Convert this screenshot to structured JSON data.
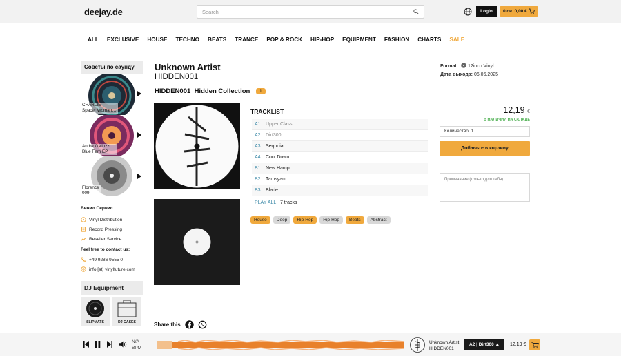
{
  "header": {
    "logo": "deejay.de",
    "search_placeholder": "Search",
    "login_label": "Login",
    "cart_label": "0 св. 0,00 €"
  },
  "nav": {
    "items": [
      "ALL",
      "EXCLUSIVE",
      "HOUSE",
      "TECHNO",
      "BEATS",
      "TRANCE",
      "POP & ROCK",
      "HIP-HOP",
      "EQUIPMENT",
      "FASHION",
      "CHARTS",
      "SALE"
    ]
  },
  "sidebar": {
    "recommend_title": "Советы по саунду",
    "recommendations": [
      {
        "line1": "CHARLIE",
        "line2": "Spacer Woman…"
      },
      {
        "line1": "Andre Galluzzi …",
        "line2": "Blue Fern EP"
      },
      {
        "line1": "Florence",
        "line2": "009"
      }
    ],
    "services_title": "Винил Сервис",
    "services": [
      "Vinyl Distribution",
      "Record Pressing",
      "Reseller Service"
    ],
    "contact_title": "Feel free to contact us:",
    "phone": "+49 9286 9555 0",
    "email": "info [at] vinylfuture.com",
    "dj_title": "DJ Equipment",
    "dj_items": [
      "SLIPMATS",
      "DJ CASES"
    ]
  },
  "release": {
    "artist": "Unknown Artist",
    "catalog": "HIDDEN001",
    "title_catalog": "HIDDEN001",
    "title_label": "Hidden Collection",
    "count_badge": "1",
    "format_label": "Format:",
    "format_value": "12inch Vinyl",
    "date_label": "Дата выхода:",
    "date_value": "06.06.2025"
  },
  "tracklist": {
    "title": "TRACKLIST",
    "tracks": [
      {
        "pos": "A1:",
        "name": "Upper Class"
      },
      {
        "pos": "A2:",
        "name": "Dirt300"
      },
      {
        "pos": "A3:",
        "name": "Sequoia"
      },
      {
        "pos": "A4:",
        "name": "Cool Down"
      },
      {
        "pos": "B1:",
        "name": "New Hamp"
      },
      {
        "pos": "B2:",
        "name": "Tamsyam"
      },
      {
        "pos": "B3:",
        "name": "Blade"
      }
    ],
    "play_all": "PLAY ALL",
    "track_count": "7 tracks"
  },
  "tags": [
    "House",
    "Deep",
    "Hip-Hop",
    "Hip-Hop",
    "Beats",
    "Abstract"
  ],
  "purchase": {
    "price": "12,19",
    "currency": "€",
    "stock": "В НАЛИЧИИ НА СКЛАДЕ",
    "qty_label": "Количество",
    "qty_value": "1",
    "add_button": "Добавьте в корзину",
    "note_placeholder": "Примечание (только для тебя)"
  },
  "share": {
    "label": "Share this"
  },
  "player": {
    "status_na": "N/A",
    "status_bpm": "BPM",
    "artist": "Unknown Artist",
    "catalog": "HIDDEN001",
    "current_track": "A2 | Dirt300 ▲",
    "price": "12,19 €"
  },
  "colors": {
    "accent": "#f0a93d",
    "link": "#3d8aa8",
    "stock": "#4caf50"
  }
}
